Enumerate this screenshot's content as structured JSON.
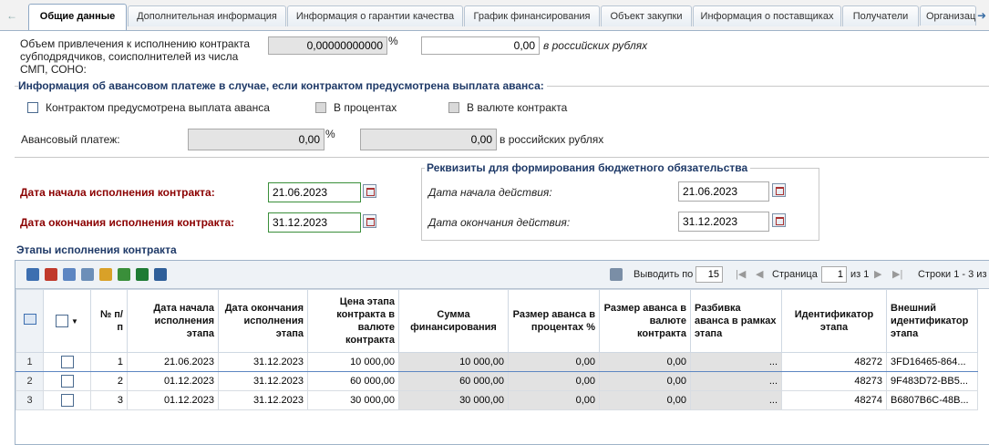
{
  "tabs": [
    "Общие данные",
    "Дополнительная информация",
    "Информация о гарантии качества",
    "График финансирования",
    "Объект закупки",
    "Информация о поставщиках",
    "Получатели",
    "Организац"
  ],
  "smp": {
    "label": "Объем привлечения к исполнению контракта субподрядчиков, соисполнителей из числа СМП, СОНО:",
    "percent_value": "0,00000000000",
    "percent_sign": "%",
    "rub_value": "0,00",
    "rub_suffix": "в российских рублях"
  },
  "advance": {
    "group_title": "Информация об авансовом платеже в случае, если контрактом предусмотрена выплата аванса:",
    "cb_advance": "Контрактом предусмотрена выплата аванса",
    "cb_percent": "В процентах",
    "cb_currency": "В валюте контракта",
    "payment_label": "Авансовый платеж:",
    "payment_percent": "0,00",
    "percent_sign": "%",
    "payment_rub": "0,00",
    "rub_suffix": "в российских рублях"
  },
  "dates": {
    "start_label": "Дата начала исполнения контракта:",
    "start_value": "21.06.2023",
    "end_label": "Дата окончания исполнения контракта:",
    "end_value": "31.12.2023"
  },
  "budget": {
    "group_title": "Реквизиты для формирования бюджетного обязательства",
    "start_label": "Дата начала действия:",
    "start_value": "21.06.2023",
    "end_label": "Дата окончания действия:",
    "end_value": "31.12.2023"
  },
  "stages": {
    "title": "Этапы исполнения контракта",
    "pager": {
      "show_label": "Выводить по",
      "page_size": "15",
      "page_label": "Страница",
      "page_value": "1",
      "of_label": "из 1",
      "rows_label": "Строки 1 - 3 из"
    },
    "columns": [
      "№ п/п",
      "Дата начала исполнения этапа",
      "Дата окончания исполнения этапа",
      "Цена этапа контракта в валюте контракта",
      "Сумма финансирования",
      "Размер аванса в процентах %",
      "Размер аванса в валюте контракта",
      "Разбивка аванса в рамках этапа",
      "Идентификатор этапа",
      "Внешний идентификатор этапа"
    ],
    "rows": [
      {
        "rn": "1",
        "n": "1",
        "start": "21.06.2023",
        "end": "31.12.2023",
        "price": "10 000,00",
        "sum": "10 000,00",
        "pct": "0,00",
        "adv": "0,00",
        "split": "...",
        "id": "48272",
        "ext": "3FD16465-864..."
      },
      {
        "rn": "2",
        "n": "2",
        "start": "01.12.2023",
        "end": "31.12.2023",
        "price": "60 000,00",
        "sum": "60 000,00",
        "pct": "0,00",
        "adv": "0,00",
        "split": "...",
        "id": "48273",
        "ext": "9F483D72-BB5..."
      },
      {
        "rn": "3",
        "n": "3",
        "start": "01.12.2023",
        "end": "31.12.2023",
        "price": "30 000,00",
        "sum": "30 000,00",
        "pct": "0,00",
        "adv": "0,00",
        "split": "...",
        "id": "48274",
        "ext": "B6807B6C-48B..."
      }
    ]
  }
}
